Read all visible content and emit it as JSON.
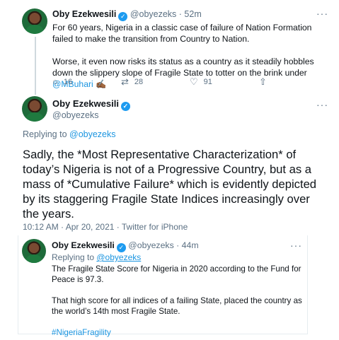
{
  "tweet1": {
    "name": "Oby Ezekwesili",
    "handle": "@obyezeks",
    "time": "· 52m",
    "para1": "For 60 years, Nigeria in a classic case of failure of Nation Formation failed to make the transition from Country to Nation.",
    "para2_prefix": "Worse, it even now risks its status as a country as it steadily hobbles down the slippery slope of Fragile State to totter on the brink under ",
    "para2_mention": "@MBuhari",
    "para2_emoji": "✍🏾",
    "replies": "16",
    "retweets": "28",
    "likes": "91"
  },
  "tweet2": {
    "name": "Oby Ezekwesili",
    "handle": "@obyezeks",
    "replying_label": "Replying to ",
    "replying_to": "@obyezeks",
    "text": "Sadly, the *Most Representative Characterization*  of today’s Nigeria  is not of a Progressive Country, but as a mass of *Cumulative Failure* which is evidently depicted by its staggering Fragile State Indices increasingly over the years.",
    "timestamp": "10:12 AM · Apr 20, 2021 · Twitter for iPhone"
  },
  "quoted": {
    "name": "Oby Ezekwesili",
    "handle": "@obyezeks",
    "time": "· 44m",
    "replying_label": "Replying to ",
    "replying_to": "@obyezeks",
    "para1": "The Fragile State Score for Nigeria in  2020 according to the Fund for Peace is 97.3.",
    "para2": "That high score for all indices of a failing State, placed the country as the world’s 14th most Fragile State.",
    "hashtag": "#NigeriaFragility"
  },
  "icons": {
    "verified": "verified-badge-icon",
    "more": "more-icon",
    "reply": "reply-icon",
    "retweet": "retweet-icon",
    "like": "like-icon",
    "share": "share-icon"
  }
}
